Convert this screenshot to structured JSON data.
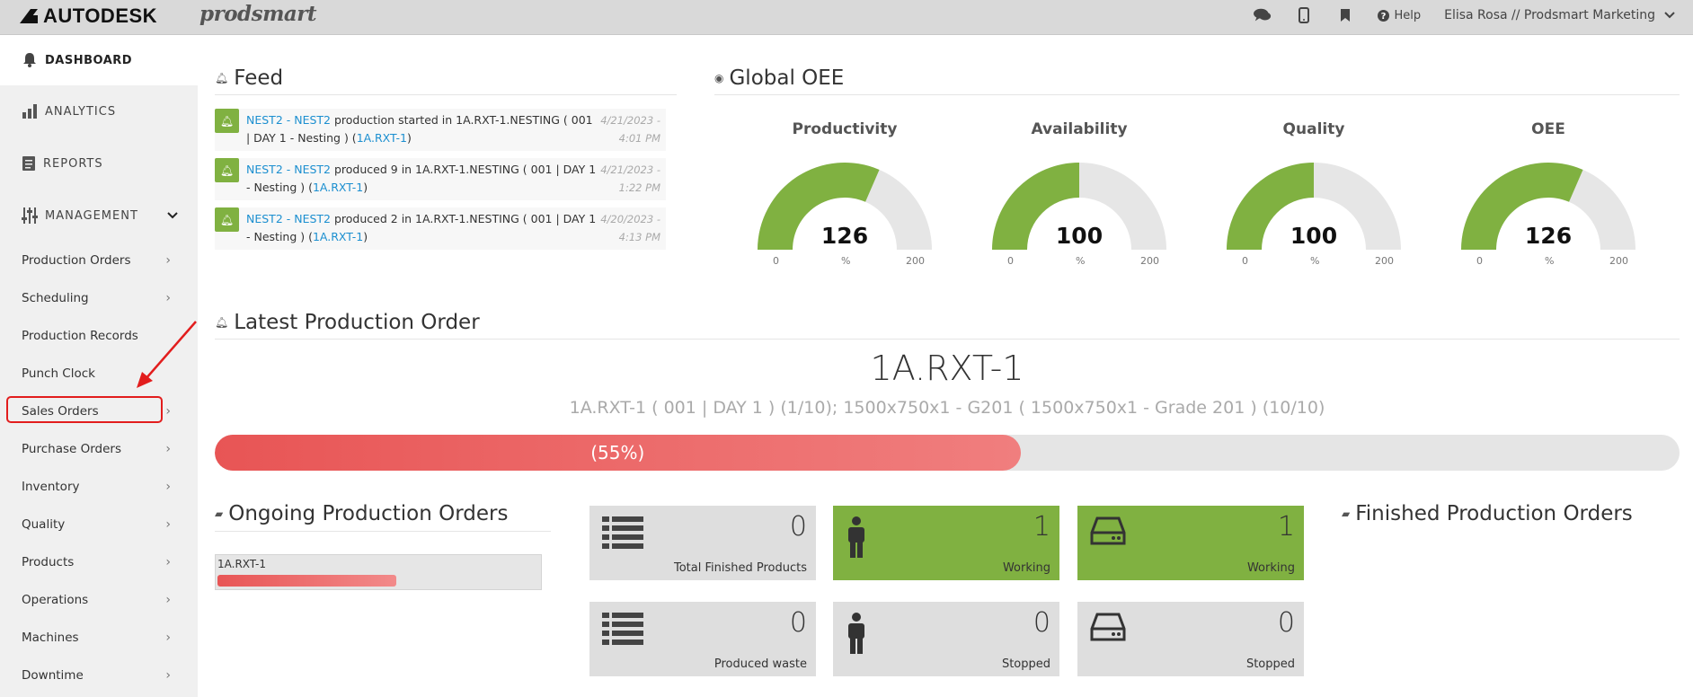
{
  "topbar": {
    "brand": "AUTODESK",
    "product": "prodsmart",
    "help_label": "Help",
    "user_label": "Elisa Rosa // Prodsmart Marketing"
  },
  "sidebar": {
    "dashboard": "DASHBOARD",
    "analytics": "ANALYTICS",
    "reports": "REPORTS",
    "management": "MANAGEMENT",
    "items": [
      {
        "label": "Production Orders",
        "arrow": true
      },
      {
        "label": "Scheduling",
        "arrow": true
      },
      {
        "label": "Production Records",
        "arrow": false
      },
      {
        "label": "Punch Clock",
        "arrow": false
      },
      {
        "label": "Sales Orders",
        "arrow": true
      },
      {
        "label": "Purchase Orders",
        "arrow": true
      },
      {
        "label": "Inventory",
        "arrow": true
      },
      {
        "label": "Quality",
        "arrow": true
      },
      {
        "label": "Products",
        "arrow": true
      },
      {
        "label": "Operations",
        "arrow": true
      },
      {
        "label": "Machines",
        "arrow": true
      },
      {
        "label": "Downtime",
        "arrow": true
      }
    ]
  },
  "feed": {
    "title": "Feed",
    "items": [
      {
        "link1": "NEST2 - NEST2",
        "text": " production started in 1A.RXT-1.NESTING ( 001 | DAY 1 - Nesting ) (",
        "link2": "1A.RXT-1",
        "end": ")",
        "date": "4/21/2023 - 4:01 PM"
      },
      {
        "link1": "NEST2 - NEST2",
        "text": " produced 9 in 1A.RXT-1.NESTING ( 001 | DAY 1 - Nesting ) (",
        "link2": "1A.RXT-1",
        "end": ")",
        "date": "4/21/2023 - 1:22 PM"
      },
      {
        "link1": "NEST2 - NEST2",
        "text": " produced 2 in 1A.RXT-1.NESTING ( 001 | DAY 1 - Nesting ) (",
        "link2": "1A.RXT-1",
        "end": ")",
        "date": "4/20/2023 - 4:13 PM"
      }
    ]
  },
  "oee": {
    "title": "Global OEE",
    "gauges": [
      {
        "label": "Productivity",
        "value": "126",
        "fraction": 0.63,
        "min": "0",
        "max": "200",
        "unit": "%"
      },
      {
        "label": "Availability",
        "value": "100",
        "fraction": 0.5,
        "min": "0",
        "max": "200",
        "unit": "%"
      },
      {
        "label": "Quality",
        "value": "100",
        "fraction": 0.5,
        "min": "0",
        "max": "200",
        "unit": "%"
      },
      {
        "label": "OEE",
        "value": "126",
        "fraction": 0.63,
        "min": "0",
        "max": "200",
        "unit": "%"
      }
    ],
    "color_fill": "#80b141",
    "color_track": "#e6e6e6"
  },
  "latest": {
    "title": "Latest Production Order",
    "order": "1A.RXT-1",
    "subtitle": "1A.RXT-1 ( 001 | DAY 1 ) (1/10); 1500x750x1 - G201 ( 1500x750x1 - Grade 201 ) (10/10)",
    "progress_label": "(55%)",
    "progress": 0.55
  },
  "ongoing": {
    "title": "Ongoing Production Orders",
    "row_label": "1A.RXT-1",
    "row_progress": 0.55
  },
  "cards": [
    {
      "icon": "list-icon",
      "value": "0",
      "label": "Total Finished Products",
      "color": "gray"
    },
    {
      "icon": "person-icon",
      "value": "1",
      "label": "Working",
      "color": "green"
    },
    {
      "icon": "machine-icon",
      "value": "1",
      "label": "Working",
      "color": "green"
    },
    {
      "icon": "list-icon",
      "value": "0",
      "label": "Produced waste",
      "color": "gray"
    },
    {
      "icon": "person-icon",
      "value": "0",
      "label": "Stopped",
      "color": "gray"
    },
    {
      "icon": "machine-icon",
      "value": "0",
      "label": "Stopped",
      "color": "gray"
    }
  ],
  "finished": {
    "title": "Finished Production Orders"
  }
}
